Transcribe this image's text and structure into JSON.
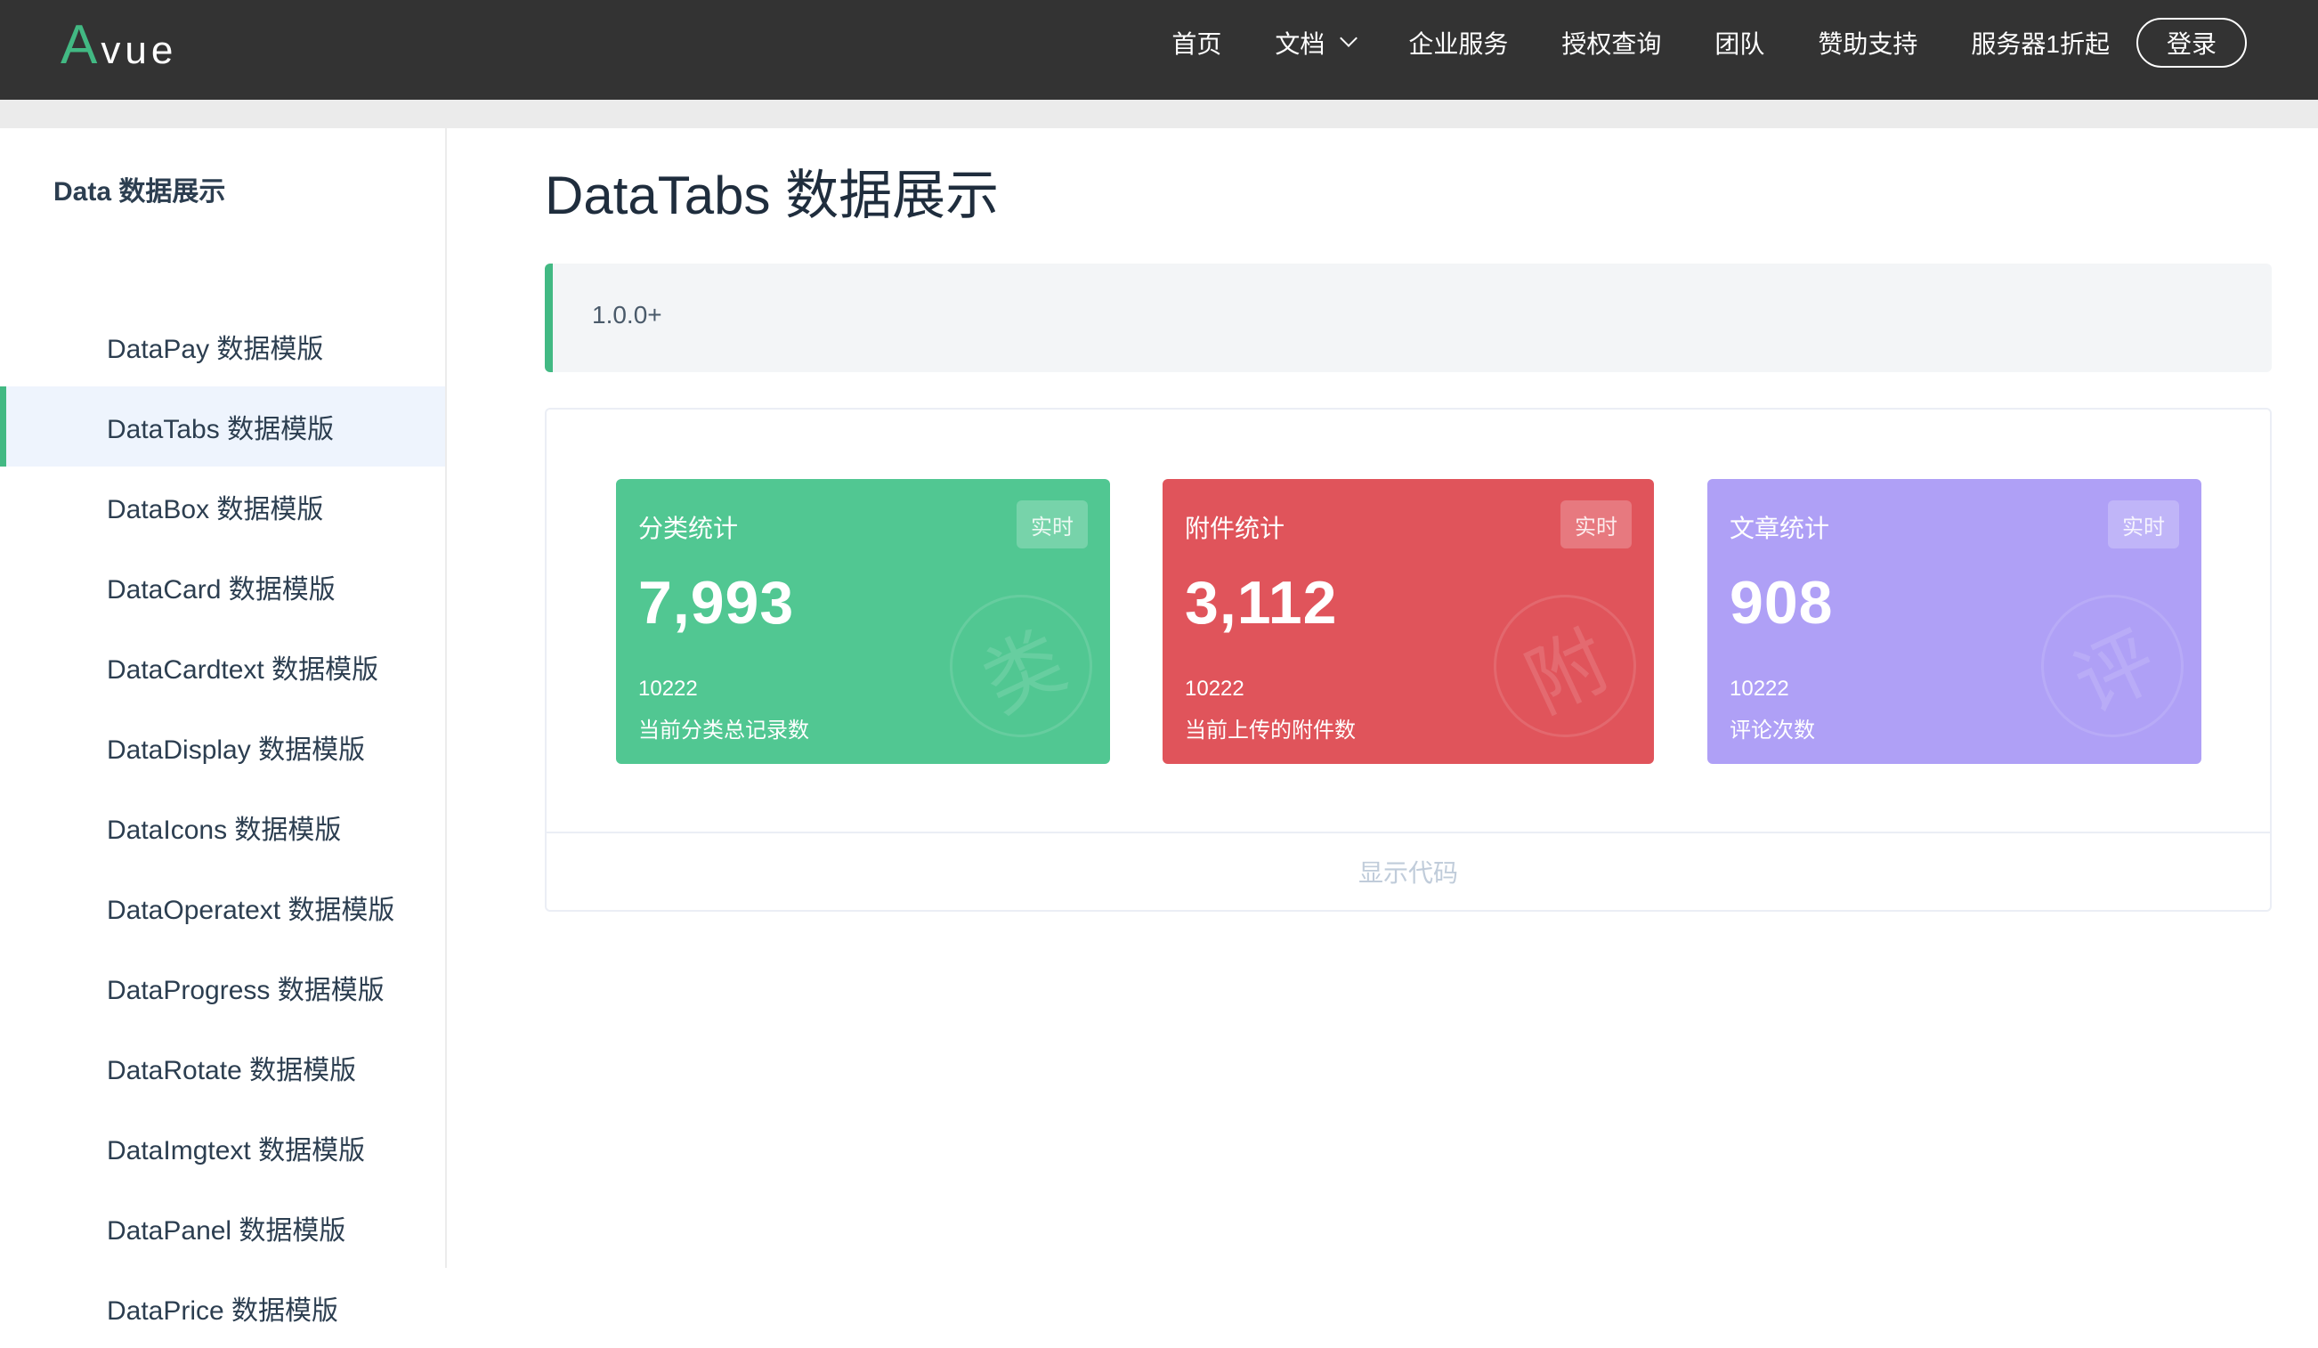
{
  "header": {
    "logo_a": "A",
    "logo_rest": "vue",
    "nav": [
      "首页",
      "文档",
      "企业服务",
      "授权查询",
      "团队",
      "赞助支持",
      "服务器1折起"
    ],
    "login": "登录"
  },
  "sidebar": {
    "group": "Data 数据展示",
    "items": [
      "DataPay 数据模版",
      "DataTabs 数据模版",
      "DataBox 数据模版",
      "DataCard 数据模版",
      "DataCardtext 数据模版",
      "DataDisplay 数据模版",
      "DataIcons 数据模版",
      "DataOperatext 数据模版",
      "DataProgress 数据模版",
      "DataRotate 数据模版",
      "DataImgtext 数据模版",
      "DataPanel 数据模版",
      "DataPrice 数据模版"
    ],
    "active_index": 1
  },
  "main": {
    "title": "DataTabs 数据展示",
    "version": "1.0.0+",
    "show_code": "显示代码",
    "cards": [
      {
        "title": "分类统计",
        "badge": "实时",
        "count": "7,993",
        "sub": "10222",
        "desc": "当前分类总记录数",
        "icon": "类",
        "color": "#51c792"
      },
      {
        "title": "附件统计",
        "badge": "实时",
        "count": "3,112",
        "sub": "10222",
        "desc": "当前上传的附件数",
        "icon": "附",
        "color": "#e0545b"
      },
      {
        "title": "文章统计",
        "badge": "实时",
        "count": "908",
        "sub": "10222",
        "desc": "评论次数",
        "icon": "评",
        "color": "#afa0f6"
      }
    ]
  }
}
